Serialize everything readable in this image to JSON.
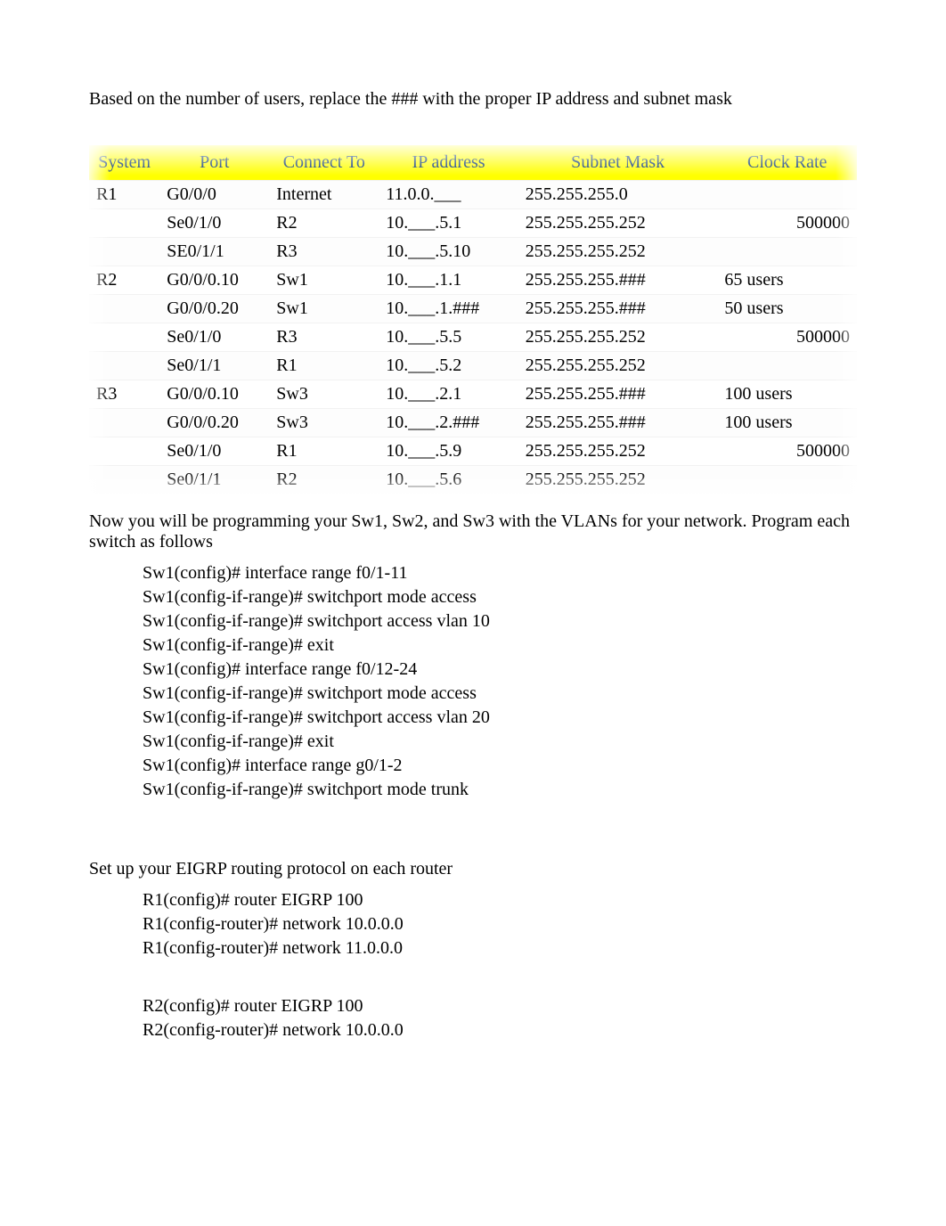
{
  "intro": "Based on the number of users, replace the ### with the proper IP address and subnet mask",
  "headers": {
    "system": "System",
    "port": "Port",
    "connect_to": "Connect To",
    "ip": "IP address",
    "subnet": "Subnet Mask",
    "clock": "Clock Rate"
  },
  "rows": [
    {
      "system": "R1",
      "port": "G0/0/0",
      "connect": "Internet",
      "ip": "11.0.0.___",
      "subnet": "255.255.255.0",
      "clock": "",
      "clk_align": "right"
    },
    {
      "system": "",
      "port": "Se0/1/0",
      "connect": "R2",
      "ip": "10.___.5.1",
      "subnet": "255.255.255.252",
      "clock": "500000",
      "clk_align": "right"
    },
    {
      "system": "",
      "port": "SE0/1/1",
      "connect": "R3",
      "ip": "10.___.5.10",
      "subnet": "255.255.255.252",
      "clock": "",
      "clk_align": "right"
    },
    {
      "system": "R2",
      "port": "G0/0/0.10",
      "connect": "Sw1",
      "ip": "10.___.1.1",
      "subnet": "255.255.255.###",
      "clock": "65 users",
      "clk_align": "left"
    },
    {
      "system": "",
      "port": "G0/0/0.20",
      "connect": "Sw1",
      "ip": "10.___.1.###",
      "subnet": "255.255.255.###",
      "clock": "50 users",
      "clk_align": "left"
    },
    {
      "system": "",
      "port": "Se0/1/0",
      "connect": "R3",
      "ip": "10.___.5.5",
      "subnet": "255.255.255.252",
      "clock": "500000",
      "clk_align": "right"
    },
    {
      "system": "",
      "port": "Se0/1/1",
      "connect": "R1",
      "ip": "10.___.5.2",
      "subnet": "255.255.255.252",
      "clock": "",
      "clk_align": "right"
    },
    {
      "system": "R3",
      "port": "G0/0/0.10",
      "connect": "Sw3",
      "ip": "10.___.2.1",
      "subnet": "255.255.255.###",
      "clock": "100 users",
      "clk_align": "left"
    },
    {
      "system": "",
      "port": "G0/0/0.20",
      "connect": "Sw3",
      "ip": "10.___.2.###",
      "subnet": "255.255.255.###",
      "clock": "100 users",
      "clk_align": "left"
    },
    {
      "system": "",
      "port": "Se0/1/0",
      "connect": "R1",
      "ip": "10.___.5.9",
      "subnet": "255.255.255.252",
      "clock": "500000",
      "clk_align": "right"
    },
    {
      "system": "",
      "port": "Se0/1/1",
      "connect": "R2",
      "ip": "10.___.5.6",
      "subnet": "255.255.255.252",
      "clock": "",
      "clk_align": "right"
    }
  ],
  "vlan_para": "Now you will be programming your Sw1, Sw2, and Sw3 with the VLANs for your network. Program each switch as follows",
  "vlan_cmds": [
    "Sw1(config)# interface range f0/1-11",
    "Sw1(config-if-range)# switchport mode access",
    "Sw1(config-if-range)# switchport access vlan 10",
    "Sw1(config-if-range)# exit",
    "Sw1(config)# interface range f0/12-24",
    "Sw1(config-if-range)# switchport mode access",
    "Sw1(config-if-range)# switchport access vlan 20",
    "Sw1(config-if-range)# exit",
    "Sw1(config)# interface range g0/1-2",
    "Sw1(config-if-range)# switchport mode trunk"
  ],
  "eigrp_para": "Set up your EIGRP routing protocol on each router",
  "eigrp_cmds1": [
    "R1(config)# router EIGRP 100",
    "R1(config-router)# network 10.0.0.0",
    "R1(config-router)# network 11.0.0.0"
  ],
  "eigrp_cmds2": [
    "R2(config)# router EIGRP 100",
    "R2(config-router)# network 10.0.0.0"
  ]
}
